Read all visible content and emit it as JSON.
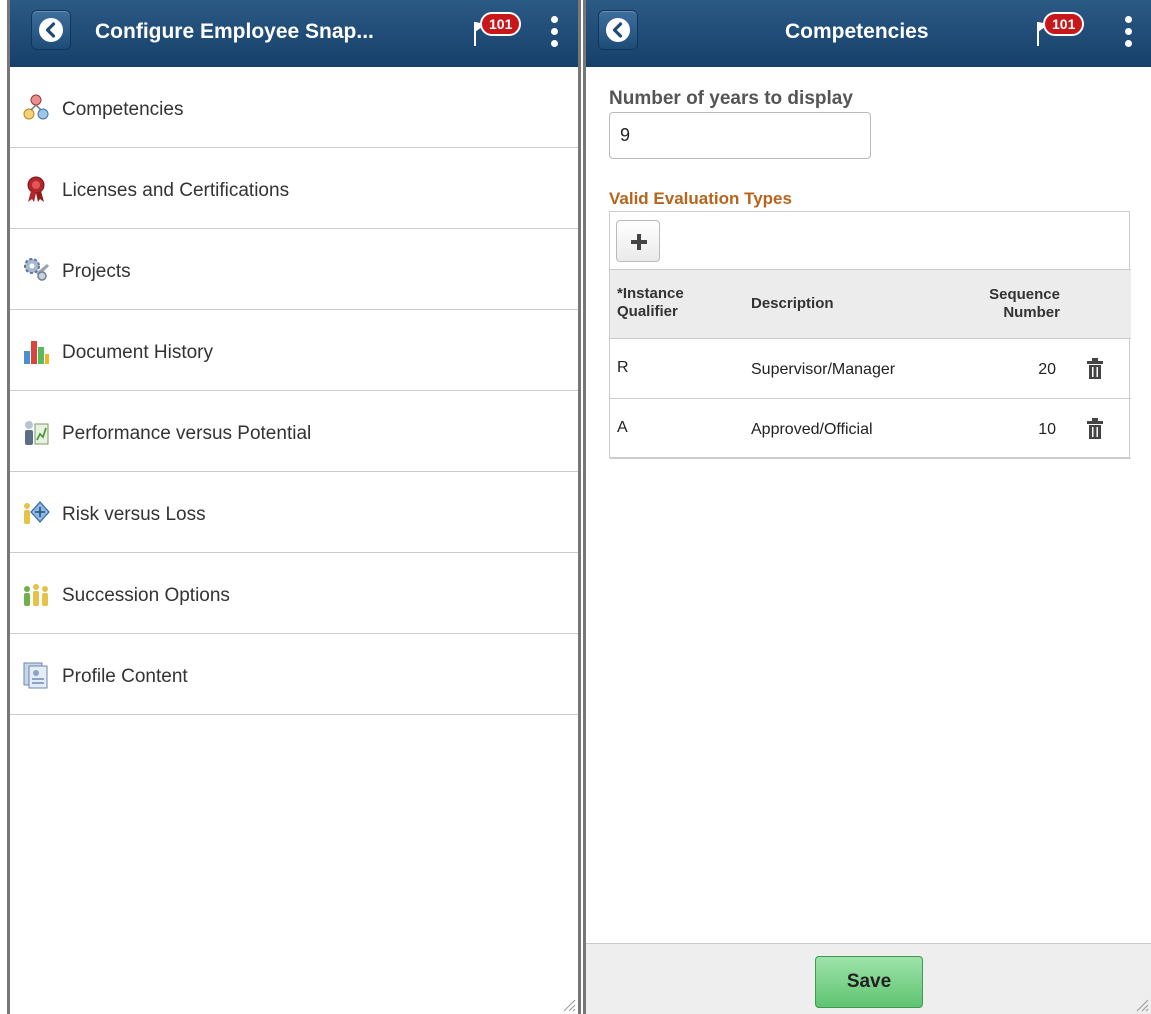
{
  "left": {
    "title": "Configure Employee Snap...",
    "notification_count": "101",
    "menu": [
      {
        "label": "Competencies",
        "icon": "competencies-icon"
      },
      {
        "label": "Licenses and Certifications",
        "icon": "certification-ribbon-icon"
      },
      {
        "label": "Projects",
        "icon": "projects-gears-icon"
      },
      {
        "label": "Document History",
        "icon": "bar-chart-icon"
      },
      {
        "label": "Performance versus Potential",
        "icon": "performance-potential-icon"
      },
      {
        "label": "Risk versus Loss",
        "icon": "risk-loss-icon"
      },
      {
        "label": "Succession Options",
        "icon": "succession-people-icon"
      },
      {
        "label": "Profile Content",
        "icon": "profile-content-icon"
      }
    ]
  },
  "right": {
    "title": "Competencies",
    "notification_count": "101",
    "years_label": "Number of years to display",
    "years_value": "9",
    "valid_types_label": "Valid Evaluation Types",
    "grid": {
      "headers": {
        "qualifier": "*Instance Qualifier",
        "description": "Description",
        "sequence": "Sequence Number"
      },
      "rows": [
        {
          "qualifier": "R",
          "description": "Supervisor/Manager",
          "sequence": "20"
        },
        {
          "qualifier": "A",
          "description": "Approved/Official",
          "sequence": "10"
        }
      ]
    },
    "save_label": "Save"
  },
  "colors": {
    "header_bg": "#1e4b76",
    "section_label": "#b5651d",
    "save_button": "#6fcb80",
    "badge": "#c8171b"
  }
}
